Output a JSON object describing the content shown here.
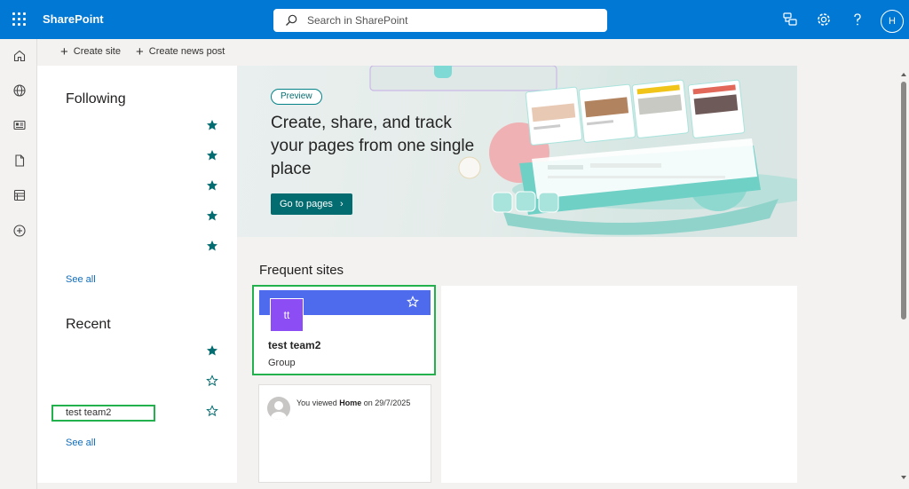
{
  "topbar": {
    "brand": "SharePoint",
    "search_placeholder": "Search in SharePoint",
    "avatar_initial": "H",
    "color": "#0078d4"
  },
  "commands": {
    "create_site": "Create site",
    "create_news_post": "Create news post"
  },
  "rail": {
    "icons": [
      "home-icon",
      "globe-icon",
      "news-icon",
      "document-icon",
      "list-icon",
      "add-circle-icon"
    ]
  },
  "following": {
    "title": "Following",
    "items": [
      {
        "name": "",
        "starred": true
      },
      {
        "name": "",
        "starred": true
      },
      {
        "name": "",
        "starred": true
      },
      {
        "name": "",
        "starred": true
      },
      {
        "name": "",
        "starred": true
      }
    ],
    "see_all": "See all"
  },
  "recent": {
    "title": "Recent",
    "items": [
      {
        "name": "",
        "starred": true
      },
      {
        "name": "",
        "starred": false
      },
      {
        "name": "test team2",
        "starred": false
      }
    ],
    "see_all": "See all"
  },
  "banner": {
    "pill": "Preview",
    "title": "Create, share, and track your pages from one single place",
    "button": "Go to pages"
  },
  "frequent": {
    "title": "Frequent sites",
    "site": {
      "initials": "tt",
      "name": "test team2",
      "type": "Group",
      "header_color": "#4f6bed",
      "tile_color": "#8c4df5"
    },
    "activity": {
      "prefix": "You viewed",
      "page": "Home",
      "middle": "on",
      "date": "29/7/2025"
    }
  }
}
